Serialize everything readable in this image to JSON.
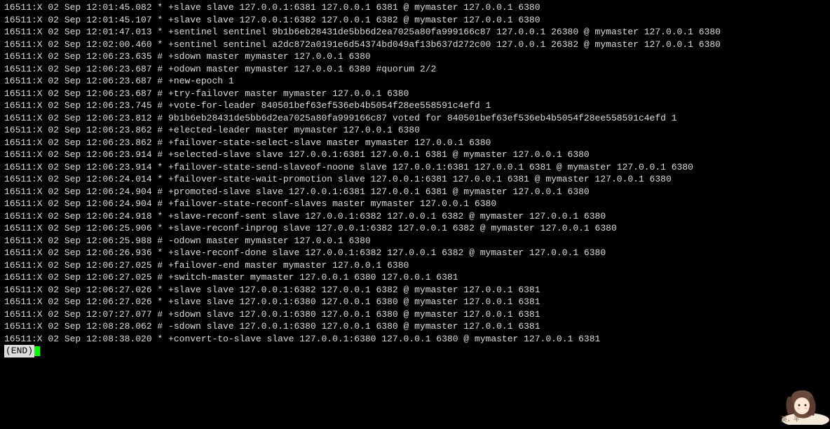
{
  "log_lines": [
    "16511:X 02 Sep 12:01:45.082 * +slave slave 127.0.0.1:6381 127.0.0.1 6381 @ mymaster 127.0.0.1 6380",
    "16511:X 02 Sep 12:01:45.107 * +slave slave 127.0.0.1:6382 127.0.0.1 6382 @ mymaster 127.0.0.1 6380",
    "16511:X 02 Sep 12:01:47.013 * +sentinel sentinel 9b1b6eb28431de5bb6d2ea7025a80fa999166c87 127.0.0.1 26380 @ mymaster 127.0.0.1 6380",
    "16511:X 02 Sep 12:02:00.460 * +sentinel sentinel a2dc872a0191e6d54374bd049af13b637d272c00 127.0.0.1 26382 @ mymaster 127.0.0.1 6380",
    "16511:X 02 Sep 12:06:23.635 # +sdown master mymaster 127.0.0.1 6380",
    "16511:X 02 Sep 12:06:23.687 # +odown master mymaster 127.0.0.1 6380 #quorum 2/2",
    "16511:X 02 Sep 12:06:23.687 # +new-epoch 1",
    "16511:X 02 Sep 12:06:23.687 # +try-failover master mymaster 127.0.0.1 6380",
    "16511:X 02 Sep 12:06:23.745 # +vote-for-leader 840501bef63ef536eb4b5054f28ee558591c4efd 1",
    "16511:X 02 Sep 12:06:23.812 # 9b1b6eb28431de5bb6d2ea7025a80fa999166c87 voted for 840501bef63ef536eb4b5054f28ee558591c4efd 1",
    "16511:X 02 Sep 12:06:23.862 # +elected-leader master mymaster 127.0.0.1 6380",
    "16511:X 02 Sep 12:06:23.862 # +failover-state-select-slave master mymaster 127.0.0.1 6380",
    "16511:X 02 Sep 12:06:23.914 # +selected-slave slave 127.0.0.1:6381 127.0.0.1 6381 @ mymaster 127.0.0.1 6380",
    "16511:X 02 Sep 12:06:23.914 * +failover-state-send-slaveof-noone slave 127.0.0.1:6381 127.0.0.1 6381 @ mymaster 127.0.0.1 6380",
    "16511:X 02 Sep 12:06:24.014 * +failover-state-wait-promotion slave 127.0.0.1:6381 127.0.0.1 6381 @ mymaster 127.0.0.1 6380",
    "16511:X 02 Sep 12:06:24.904 # +promoted-slave slave 127.0.0.1:6381 127.0.0.1 6381 @ mymaster 127.0.0.1 6380",
    "16511:X 02 Sep 12:06:24.904 # +failover-state-reconf-slaves master mymaster 127.0.0.1 6380",
    "16511:X 02 Sep 12:06:24.918 * +slave-reconf-sent slave 127.0.0.1:6382 127.0.0.1 6382 @ mymaster 127.0.0.1 6380",
    "16511:X 02 Sep 12:06:25.906 * +slave-reconf-inprog slave 127.0.0.1:6382 127.0.0.1 6382 @ mymaster 127.0.0.1 6380",
    "16511:X 02 Sep 12:06:25.988 # -odown master mymaster 127.0.0.1 6380",
    "16511:X 02 Sep 12:06:26.936 * +slave-reconf-done slave 127.0.0.1:6382 127.0.0.1 6382 @ mymaster 127.0.0.1 6380",
    "16511:X 02 Sep 12:06:27.025 # +failover-end master mymaster 127.0.0.1 6380",
    "16511:X 02 Sep 12:06:27.025 # +switch-master mymaster 127.0.0.1 6380 127.0.0.1 6381",
    "16511:X 02 Sep 12:06:27.026 * +slave slave 127.0.0.1:6382 127.0.0.1 6382 @ mymaster 127.0.0.1 6381",
    "16511:X 02 Sep 12:06:27.026 * +slave slave 127.0.0.1:6380 127.0.0.1 6380 @ mymaster 127.0.0.1 6381",
    "16511:X 02 Sep 12:07:27.077 # +sdown slave 127.0.0.1:6380 127.0.0.1 6380 @ mymaster 127.0.0.1 6381",
    "16511:X 02 Sep 12:08:28.062 # -sdown slave 127.0.0.1:6380 127.0.0.1 6380 @ mymaster 127.0.0.1 6381",
    "16511:X 02 Sep 12:08:38.020 * +convert-to-slave slave 127.0.0.1:6380 127.0.0.1 6380 @ mymaster 127.0.0.1 6381"
  ],
  "end_marker": "(END)",
  "avatar_label": "英，半"
}
